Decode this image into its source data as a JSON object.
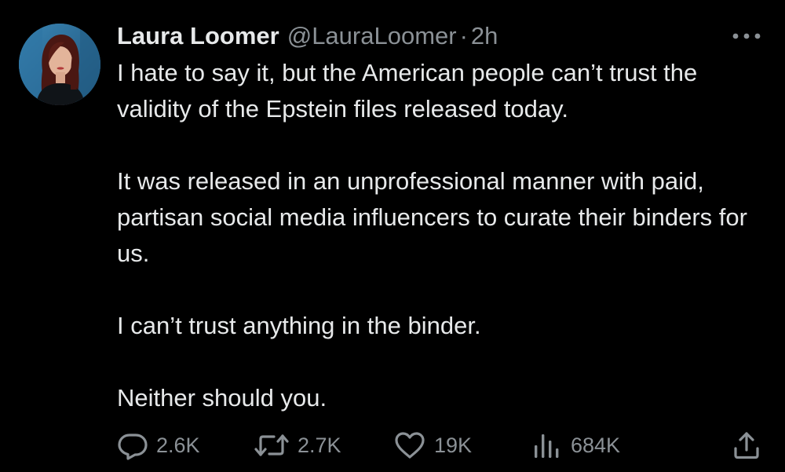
{
  "tweet": {
    "author": {
      "display_name": "Laura Loomer",
      "handle": "@LauraLoomer",
      "avatar": "profile-photo"
    },
    "separator": "·",
    "time": "2h",
    "more_icon": "more-horizontal-icon",
    "paragraphs": [
      "I hate to say it, but the American people can’t trust the validity of the Epstein files released today.",
      "It was released in an unprofessional manner with paid, partisan social media influencers to curate their binders for us.",
      "I can’t trust anything in the binder.",
      "Neither should you."
    ],
    "actions": {
      "reply": {
        "icon": "reply-icon",
        "count": "2.6K"
      },
      "repost": {
        "icon": "repost-icon",
        "count": "2.7K"
      },
      "like": {
        "icon": "heart-icon",
        "count": "19K"
      },
      "views": {
        "icon": "views-icon",
        "count": "684K"
      },
      "share": {
        "icon": "share-icon"
      }
    },
    "colors": {
      "background": "#000000",
      "text": "#e7e9ea",
      "secondary": "#8b9196"
    }
  }
}
